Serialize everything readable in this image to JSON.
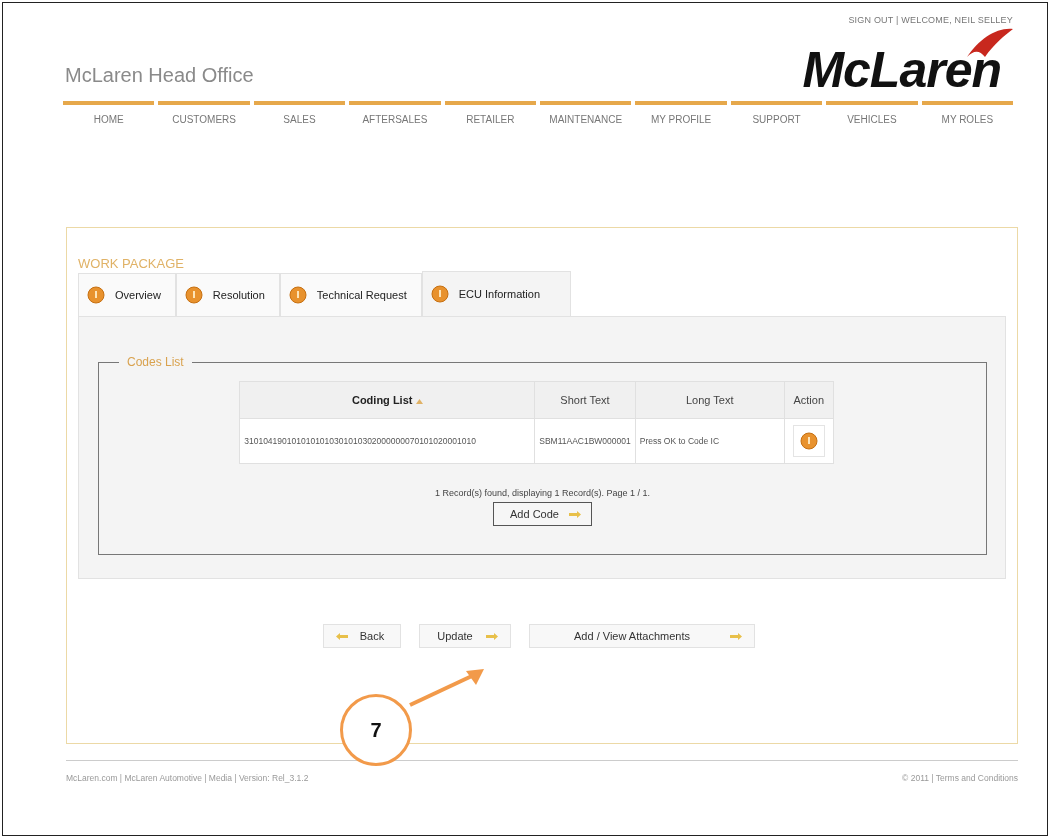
{
  "header": {
    "user_links": "SIGN OUT | WELCOME, NEIL SELLEY",
    "site_title": "McLaren Head Office",
    "logo": "McLaren"
  },
  "nav": [
    "HOME",
    "CUSTOMERS",
    "SALES",
    "AFTERSALES",
    "RETAILER",
    "MAINTENANCE",
    "MY PROFILE",
    "SUPPORT",
    "VEHICLES",
    "MY ROLES"
  ],
  "work_package": {
    "title": "WORK PACKAGE",
    "tabs": [
      {
        "label": "Overview",
        "selected": false
      },
      {
        "label": "Resolution",
        "selected": false
      },
      {
        "label": "Technical Request",
        "selected": false
      },
      {
        "label": "ECU Information",
        "selected": true
      }
    ],
    "codes_list": {
      "legend": "Codes List",
      "columns": [
        "Coding List",
        "Short Text",
        "Long Text",
        "Action"
      ],
      "rows": [
        {
          "coding_list": "3101041901010101010301010302000000070101020001010",
          "short_text": "SBM11AAC1BW000001",
          "long_text": "Press OK to Code IC"
        }
      ],
      "pagination": "1 Record(s) found, displaying 1 Record(s). Page 1 / 1.",
      "add_button": "Add Code"
    },
    "buttons": [
      {
        "label": "Back",
        "kind": "back"
      },
      {
        "label": "Update",
        "kind": "forward"
      },
      {
        "label": "Add / View Attachments",
        "kind": "forward"
      }
    ]
  },
  "footer": {
    "left": "McLaren.com | McLaren Automotive | Media | Version: Rel_3.1.2",
    "right": "© 2011 | Terms and Conditions"
  },
  "annotation": {
    "label": "7"
  }
}
